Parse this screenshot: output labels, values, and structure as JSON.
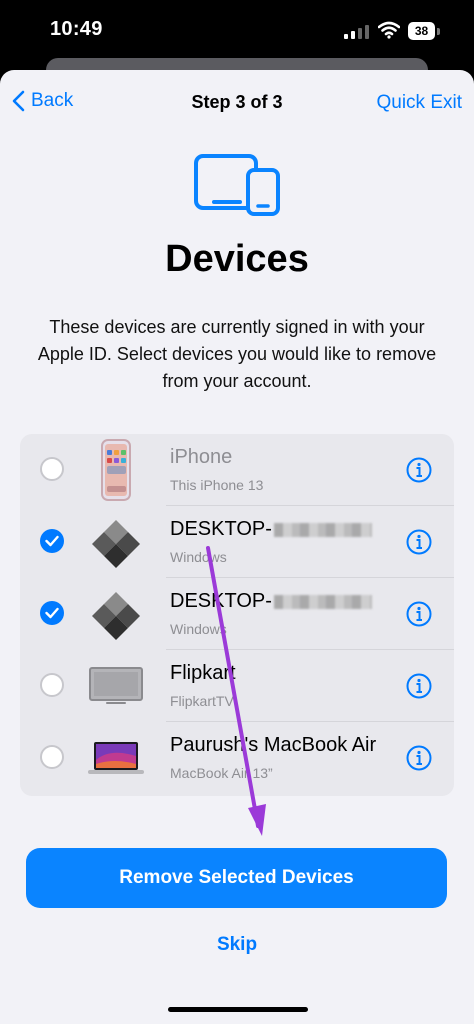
{
  "status_bar": {
    "time": "10:49",
    "battery": "38"
  },
  "nav": {
    "back_label": "Back",
    "title": "Step 3 of 3",
    "exit_label": "Quick Exit"
  },
  "heading": "Devices",
  "description": "These devices are currently signed in with your Apple ID. Select devices you would like to remove from your account.",
  "devices": [
    {
      "name": "iPhone",
      "subtitle": "This iPhone 13",
      "selected": false,
      "icon": "iphone-icon"
    },
    {
      "name": "DESKTOP-",
      "subtitle": "Windows",
      "selected": true,
      "icon": "windows-icon"
    },
    {
      "name": "DESKTOP-",
      "subtitle": "Windows",
      "selected": true,
      "icon": "windows-icon"
    },
    {
      "name": "Flipkart",
      "subtitle": "FlipkartTV",
      "selected": false,
      "icon": "tv-icon"
    },
    {
      "name": "Paurush's MacBook Air",
      "subtitle": "MacBook Air 13”",
      "selected": false,
      "icon": "macbook-icon"
    }
  ],
  "primary_button": "Remove Selected Devices",
  "skip_label": "Skip",
  "colors": {
    "accent": "#007aff",
    "button": "#0a84ff",
    "annotation_arrow": "#9b3ad8"
  }
}
